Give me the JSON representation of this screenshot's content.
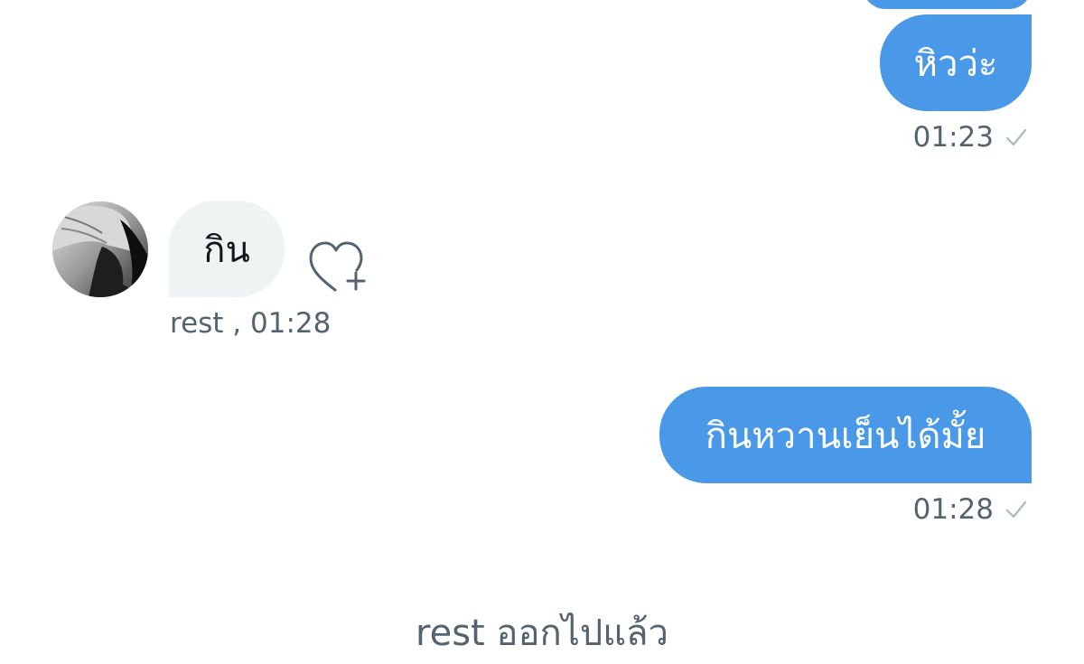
{
  "conversation": {
    "messages": [
      {
        "direction": "outgoing",
        "text": "",
        "time": ""
      },
      {
        "direction": "outgoing",
        "text": "หิวว่ะ",
        "time": "01:23"
      },
      {
        "direction": "incoming",
        "text": "กิน",
        "sender": "rest",
        "time_label": "rest  , 01:28"
      },
      {
        "direction": "outgoing",
        "text": "กินหวานเย็นได้มั้ย",
        "time": "01:28"
      }
    ],
    "system_message": "rest ออกไปแล้ว"
  },
  "colors": {
    "outgoing_bubble": "#4a99e9",
    "incoming_bubble": "#eff3f4",
    "meta_text": "#536471"
  },
  "icons": {
    "read_receipt": "check-icon",
    "reaction": "heart-plus-icon",
    "avatar": "user-avatar"
  }
}
